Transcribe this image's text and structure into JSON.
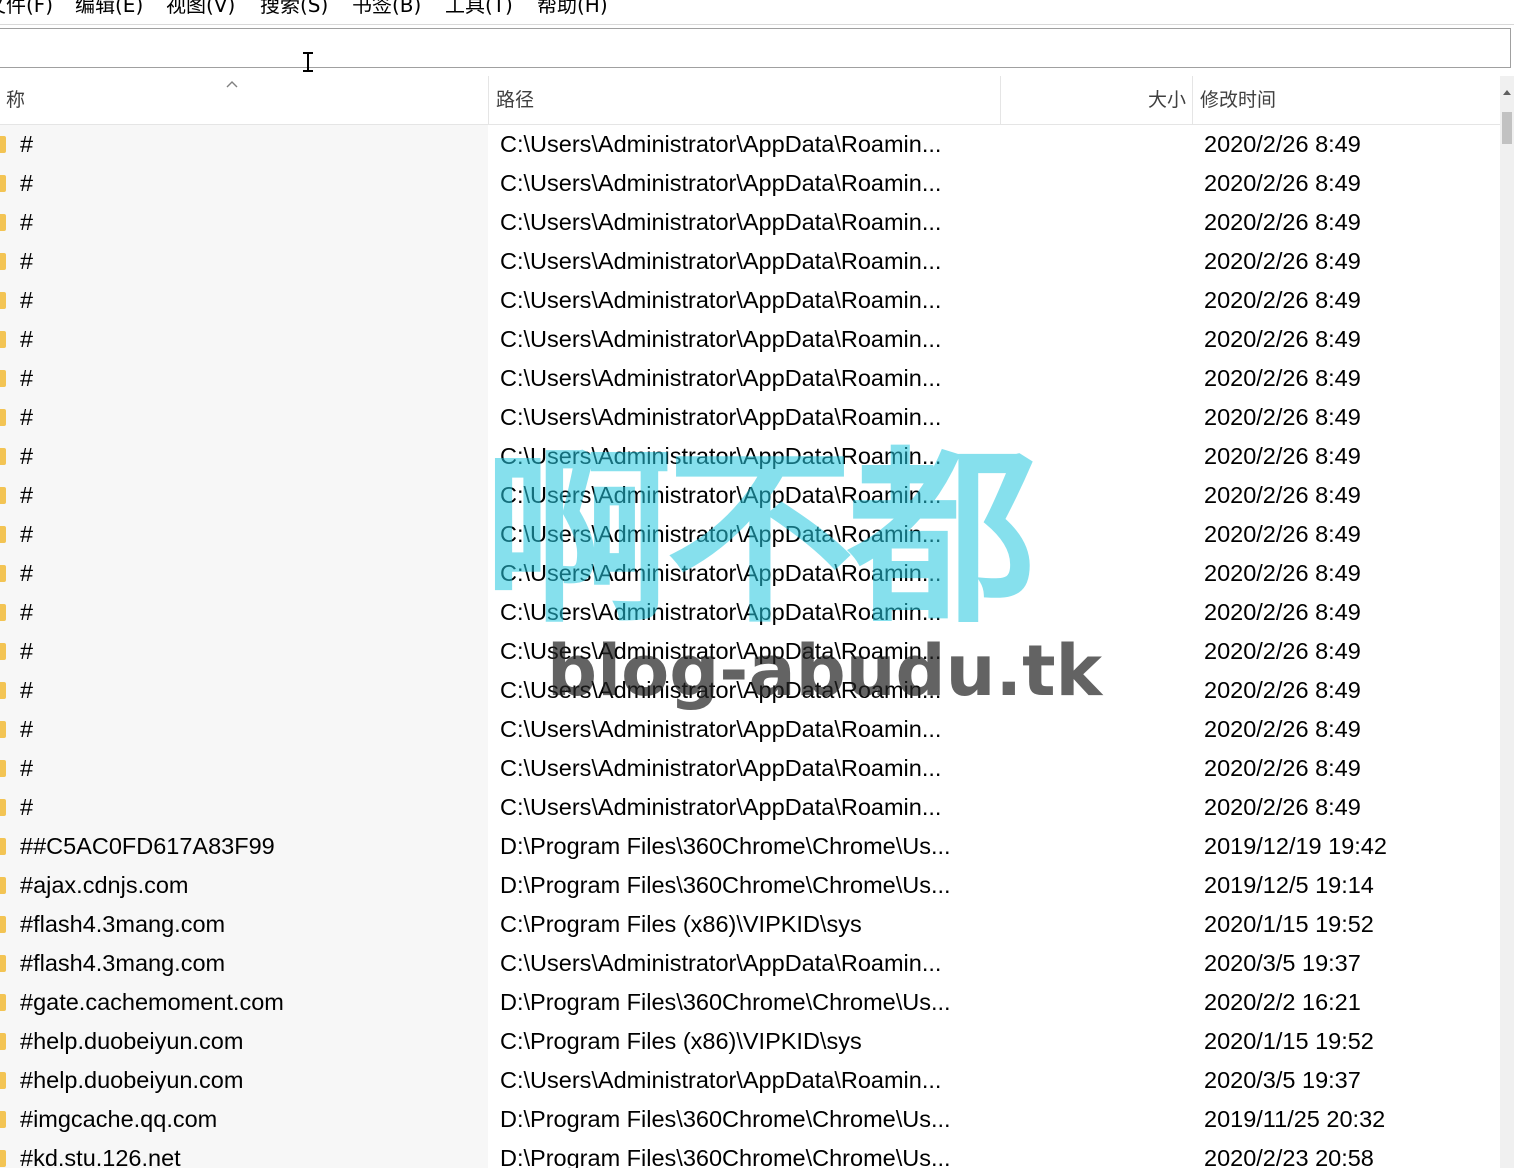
{
  "menu": [
    "文件(F)",
    "编辑(E)",
    "视图(V)",
    "搜索(S)",
    "书签(B)",
    "工具(T)",
    "帮助(H)"
  ],
  "search": {
    "value": ""
  },
  "columns": {
    "name": "称",
    "path": "路径",
    "size": "大小",
    "modified": "修改时间"
  },
  "rows": [
    {
      "name": "#",
      "path": "C:\\Users\\Administrator\\AppData\\Roamin...",
      "size": "",
      "modified": "2020/2/26 8:49"
    },
    {
      "name": "#",
      "path": "C:\\Users\\Administrator\\AppData\\Roamin...",
      "size": "",
      "modified": "2020/2/26 8:49"
    },
    {
      "name": "#",
      "path": "C:\\Users\\Administrator\\AppData\\Roamin...",
      "size": "",
      "modified": "2020/2/26 8:49"
    },
    {
      "name": "#",
      "path": "C:\\Users\\Administrator\\AppData\\Roamin...",
      "size": "",
      "modified": "2020/2/26 8:49"
    },
    {
      "name": "#",
      "path": "C:\\Users\\Administrator\\AppData\\Roamin...",
      "size": "",
      "modified": "2020/2/26 8:49"
    },
    {
      "name": "#",
      "path": "C:\\Users\\Administrator\\AppData\\Roamin...",
      "size": "",
      "modified": "2020/2/26 8:49"
    },
    {
      "name": "#",
      "path": "C:\\Users\\Administrator\\AppData\\Roamin...",
      "size": "",
      "modified": "2020/2/26 8:49"
    },
    {
      "name": "#",
      "path": "C:\\Users\\Administrator\\AppData\\Roamin...",
      "size": "",
      "modified": "2020/2/26 8:49"
    },
    {
      "name": "#",
      "path": "C:\\Users\\Administrator\\AppData\\Roamin...",
      "size": "",
      "modified": "2020/2/26 8:49"
    },
    {
      "name": "#",
      "path": "C:\\Users\\Administrator\\AppData\\Roamin...",
      "size": "",
      "modified": "2020/2/26 8:49"
    },
    {
      "name": "#",
      "path": "C:\\Users\\Administrator\\AppData\\Roamin...",
      "size": "",
      "modified": "2020/2/26 8:49"
    },
    {
      "name": "#",
      "path": "C:\\Users\\Administrator\\AppData\\Roamin...",
      "size": "",
      "modified": "2020/2/26 8:49"
    },
    {
      "name": "#",
      "path": "C:\\Users\\Administrator\\AppData\\Roamin...",
      "size": "",
      "modified": "2020/2/26 8:49"
    },
    {
      "name": "#",
      "path": "C:\\Users\\Administrator\\AppData\\Roamin...",
      "size": "",
      "modified": "2020/2/26 8:49"
    },
    {
      "name": "#",
      "path": "C:\\Users\\Administrator\\AppData\\Roamin...",
      "size": "",
      "modified": "2020/2/26 8:49"
    },
    {
      "name": "#",
      "path": "C:\\Users\\Administrator\\AppData\\Roamin...",
      "size": "",
      "modified": "2020/2/26 8:49"
    },
    {
      "name": "#",
      "path": "C:\\Users\\Administrator\\AppData\\Roamin...",
      "size": "",
      "modified": "2020/2/26 8:49"
    },
    {
      "name": "#",
      "path": "C:\\Users\\Administrator\\AppData\\Roamin...",
      "size": "",
      "modified": "2020/2/26 8:49"
    },
    {
      "name": "##C5AC0FD617A83F99",
      "path": "D:\\Program Files\\360Chrome\\Chrome\\Us...",
      "size": "",
      "modified": "2019/12/19 19:42"
    },
    {
      "name": "#ajax.cdnjs.com",
      "path": "D:\\Program Files\\360Chrome\\Chrome\\Us...",
      "size": "",
      "modified": "2019/12/5 19:14"
    },
    {
      "name": "#flash4.3mang.com",
      "path": "C:\\Program Files (x86)\\VIPKID\\sys",
      "size": "",
      "modified": "2020/1/15 19:52"
    },
    {
      "name": "#flash4.3mang.com",
      "path": "C:\\Users\\Administrator\\AppData\\Roamin...",
      "size": "",
      "modified": "2020/3/5 19:37"
    },
    {
      "name": "#gate.cachemoment.com",
      "path": "D:\\Program Files\\360Chrome\\Chrome\\Us...",
      "size": "",
      "modified": "2020/2/2 16:21"
    },
    {
      "name": "#help.duobeiyun.com",
      "path": "C:\\Program Files (x86)\\VIPKID\\sys",
      "size": "",
      "modified": "2020/1/15 19:52"
    },
    {
      "name": "#help.duobeiyun.com",
      "path": "C:\\Users\\Administrator\\AppData\\Roamin...",
      "size": "",
      "modified": "2020/3/5 19:37"
    },
    {
      "name": "#imgcache.qq.com",
      "path": "D:\\Program Files\\360Chrome\\Chrome\\Us...",
      "size": "",
      "modified": "2019/11/25 20:32"
    },
    {
      "name": "#kd.stu.126.net",
      "path": "D:\\Program Files\\360Chrome\\Chrome\\Us...",
      "size": "",
      "modified": "2020/2/23 20:58"
    }
  ],
  "watermark": {
    "main": "啊不都",
    "sub": "blog-abudu.tk"
  },
  "colors": {
    "folder": "#f3c454",
    "watermark": "#25c8e0"
  }
}
